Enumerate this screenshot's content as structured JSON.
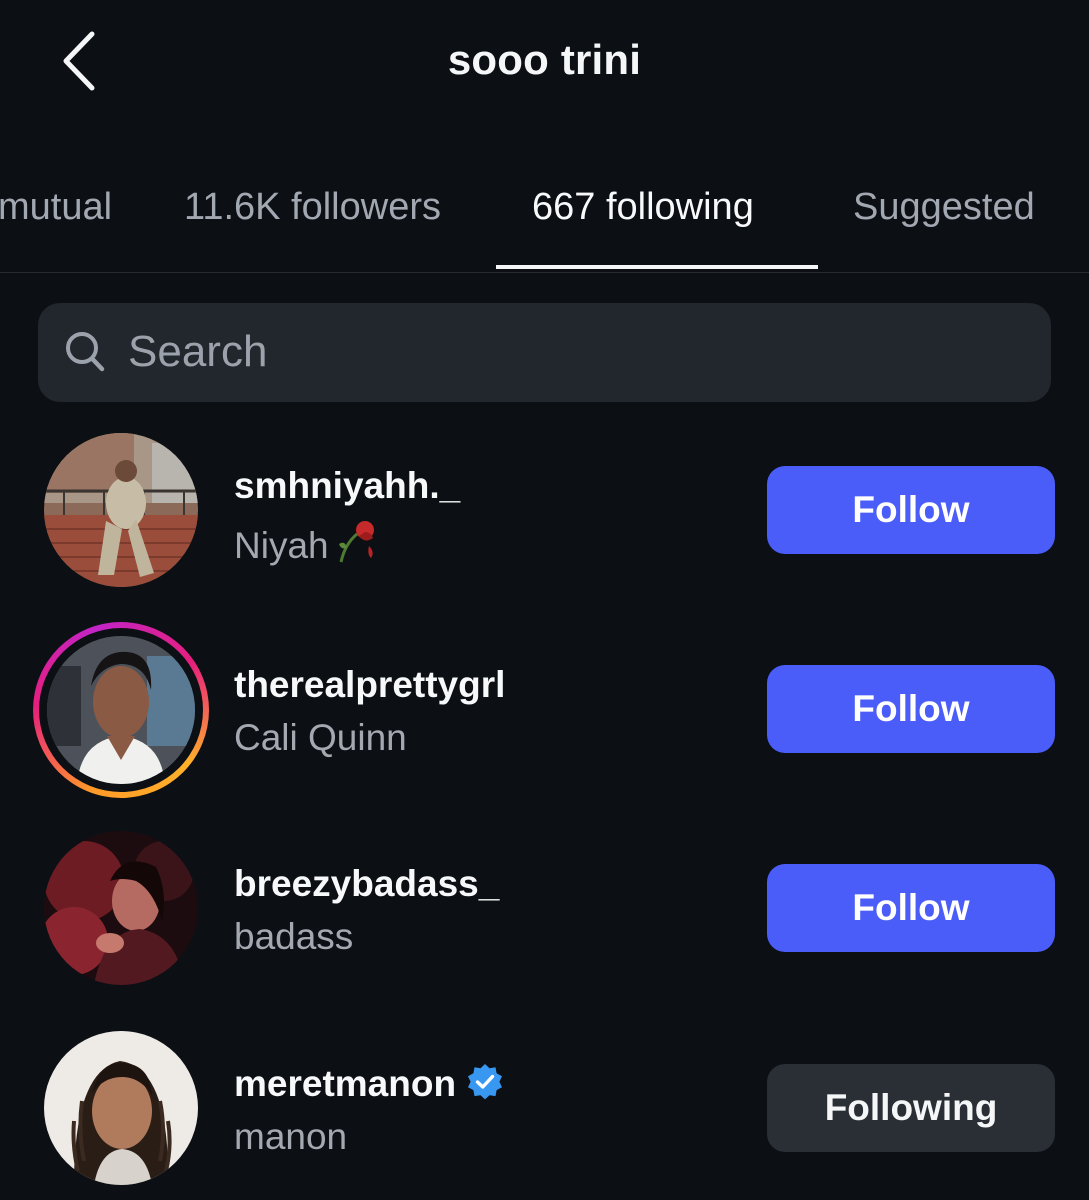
{
  "header": {
    "title": "sooo trini",
    "back_icon": "chevron-left-icon"
  },
  "tabs": [
    {
      "label": "mutual",
      "active": false
    },
    {
      "label": "11.6K followers",
      "active": false
    },
    {
      "label": "667 following",
      "active": true
    },
    {
      "label": "Suggested",
      "active": false
    }
  ],
  "search": {
    "placeholder": "Search",
    "icon": "search-icon"
  },
  "users": [
    {
      "username": "smhniyahh._",
      "full_name": "Niyah",
      "name_emoji": "wilted-rose-icon",
      "verified": false,
      "story_ring": false,
      "button": "Follow"
    },
    {
      "username": "therealprettygrl",
      "full_name": "Cali Quinn",
      "verified": false,
      "story_ring": true,
      "button": "Follow"
    },
    {
      "username": "breezybadass_",
      "full_name": "badass",
      "verified": false,
      "story_ring": false,
      "button": "Follow"
    },
    {
      "username": "meretmanon",
      "full_name": "manon",
      "verified": true,
      "story_ring": false,
      "button": "Following"
    }
  ],
  "colors": {
    "background": "#0c0f14",
    "follow_button": "#4a5df9",
    "following_button": "#2a2e35",
    "verified_badge": "#3897f0",
    "secondary_text": "#a4a9b1"
  }
}
